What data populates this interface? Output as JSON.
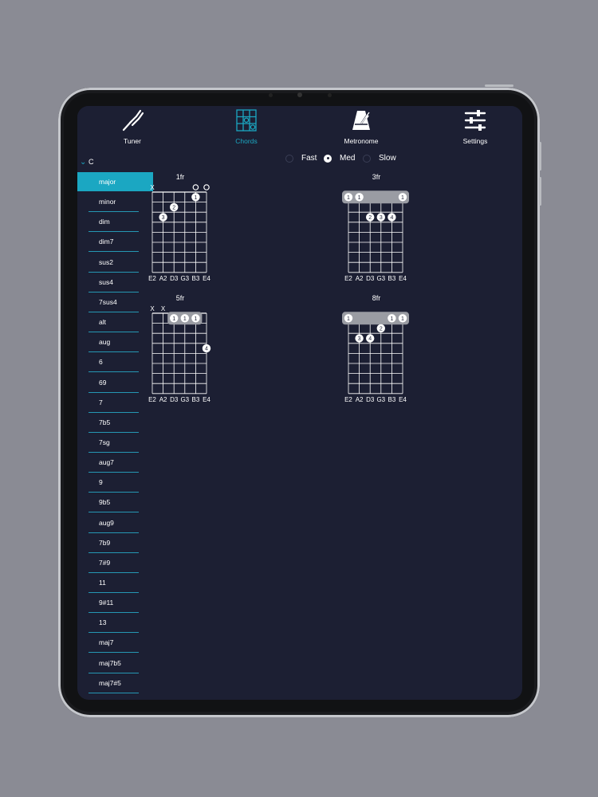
{
  "tabs": [
    {
      "label": "Tuner",
      "icon": "tuning-fork-icon",
      "active": false
    },
    {
      "label": "Chords",
      "icon": "chord-grid-icon",
      "active": true
    },
    {
      "label": "Metronome",
      "icon": "metronome-icon",
      "active": false
    },
    {
      "label": "Settings",
      "icon": "sliders-icon",
      "active": false
    }
  ],
  "sidebar": {
    "key": "C",
    "items": [
      "major",
      "minor",
      "dim",
      "dim7",
      "sus2",
      "sus4",
      "7sus4",
      "alt",
      "aug",
      "6",
      "69",
      "7",
      "7b5",
      "7sg",
      "aug7",
      "9",
      "9b5",
      "aug9",
      "7b9",
      "7#9",
      "11",
      "9#11",
      "13",
      "maj7",
      "maj7b5",
      "maj7#5"
    ],
    "selected": "major"
  },
  "speed": {
    "options": [
      "Fast",
      "Med",
      "Slow"
    ],
    "selected": "Med"
  },
  "colors": {
    "accent": "#1ba7c2",
    "background": "#1c1f33",
    "barre": "#9a9ca3"
  },
  "chords": [
    {
      "fret_label": "1fr",
      "markers": [
        "X",
        "",
        "",
        "",
        "O",
        "O"
      ],
      "barre": null,
      "dots": [
        {
          "string": 2,
          "fret": 3,
          "finger": "3"
        },
        {
          "string": 3,
          "fret": 2,
          "finger": "2"
        },
        {
          "string": 5,
          "fret": 1,
          "finger": "1"
        }
      ]
    },
    {
      "fret_label": "3fr",
      "markers": [
        "",
        "",
        "",
        "",
        "",
        ""
      ],
      "barre": {
        "fret": 1,
        "from": 1,
        "to": 6,
        "fingers": [
          {
            "string": 1,
            "finger": "1"
          },
          {
            "string": 2,
            "finger": "1"
          },
          {
            "string": 6,
            "finger": "1"
          }
        ]
      },
      "dots": [
        {
          "string": 3,
          "fret": 3,
          "finger": "2"
        },
        {
          "string": 4,
          "fret": 3,
          "finger": "3"
        },
        {
          "string": 5,
          "fret": 3,
          "finger": "4"
        }
      ]
    },
    {
      "fret_label": "5fr",
      "markers": [
        "X",
        "X",
        "",
        "",
        "",
        ""
      ],
      "barre": {
        "fret": 1,
        "from": 3,
        "to": 5,
        "fingers": [
          {
            "string": 3,
            "finger": "1"
          },
          {
            "string": 4,
            "finger": "1"
          },
          {
            "string": 5,
            "finger": "1"
          }
        ]
      },
      "dots": [
        {
          "string": 6,
          "fret": 4,
          "finger": "4"
        }
      ]
    },
    {
      "fret_label": "8fr",
      "markers": [
        "",
        "",
        "",
        "",
        "",
        ""
      ],
      "barre": {
        "fret": 1,
        "from": 1,
        "to": 6,
        "fingers": [
          {
            "string": 1,
            "finger": "1"
          },
          {
            "string": 5,
            "finger": "1"
          },
          {
            "string": 6,
            "finger": "1"
          }
        ]
      },
      "dots": [
        {
          "string": 4,
          "fret": 2,
          "finger": "2"
        },
        {
          "string": 2,
          "fret": 3,
          "finger": "3"
        },
        {
          "string": 3,
          "fret": 3,
          "finger": "4"
        }
      ]
    }
  ],
  "string_names": [
    "E2",
    "A2",
    "D3",
    "G3",
    "B3",
    "E4"
  ]
}
